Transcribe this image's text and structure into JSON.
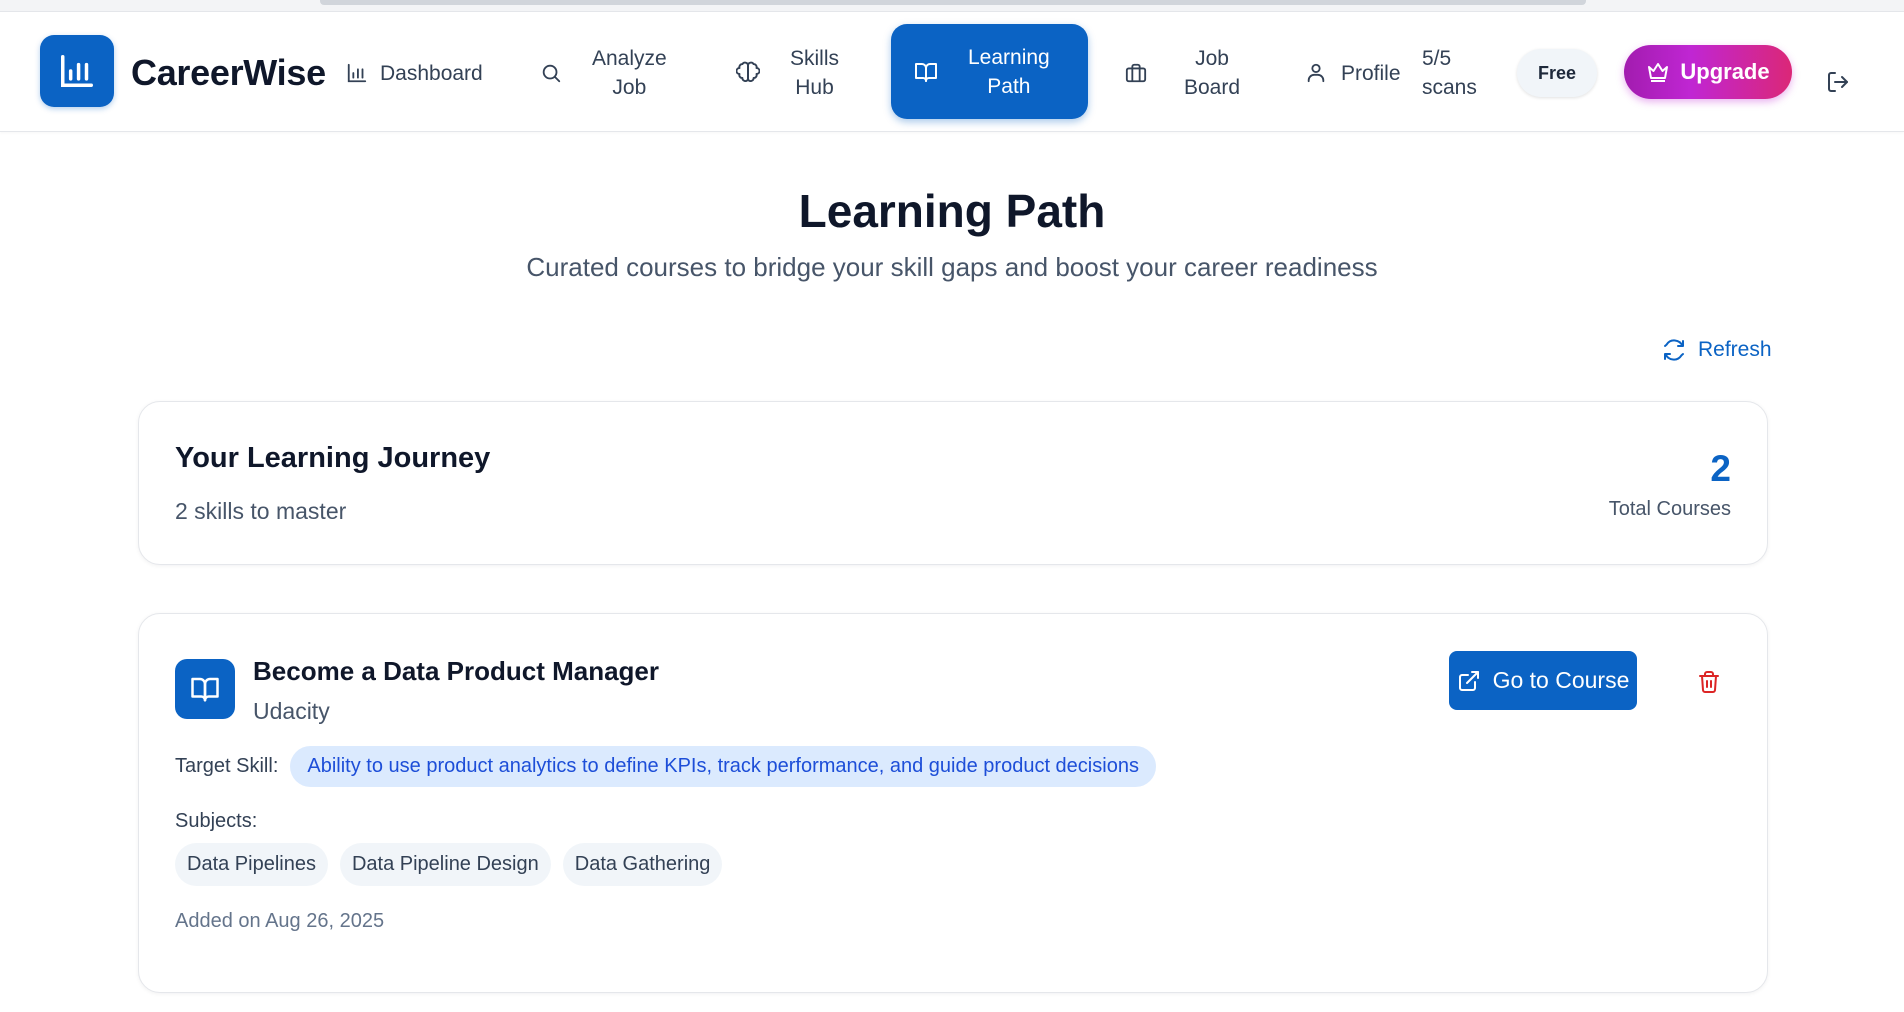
{
  "app": {
    "brand": "CareerWise",
    "accent_color": "#0b63c4"
  },
  "nav": {
    "items": [
      {
        "label": "Dashboard",
        "icon": "bar-chart-icon",
        "active": false
      },
      {
        "label_line1": "Analyze",
        "label_line2": "Job",
        "icon": "search-icon",
        "active": false
      },
      {
        "label_line1": "Skills",
        "label_line2": "Hub",
        "icon": "brain-icon",
        "active": false
      },
      {
        "label_line1": "Learning",
        "label_line2": "Path",
        "icon": "book-open-icon",
        "active": true
      },
      {
        "label_line1": "Job",
        "label_line2": "Board",
        "icon": "briefcase-icon",
        "active": false
      },
      {
        "label": "Profile",
        "icon": "user-icon",
        "active": false
      }
    ],
    "scans_line1": "5/5",
    "scans_line2": "scans",
    "plan_badge": "Free",
    "upgrade_label": "Upgrade",
    "upgrade_icon": "crown-icon",
    "logout_icon": "logout-icon"
  },
  "page": {
    "title": "Learning Path",
    "subtitle": "Curated courses to bridge your skill gaps and boost your career readiness",
    "refresh_label": "Refresh",
    "refresh_icon": "refresh-icon"
  },
  "journey": {
    "title": "Your Learning Journey",
    "subtitle": "2 skills to master",
    "total_count": "2",
    "total_label": "Total Courses"
  },
  "courses": [
    {
      "title": "Become a Data Product Manager",
      "provider": "Udacity",
      "go_label": "Go to Course",
      "target_label": "Target Skill:",
      "target_skill": "Ability to use product analytics to define KPIs, track performance, and guide product decisions",
      "subjects_label": "Subjects:",
      "subjects": [
        "Data Pipelines",
        "Data Pipeline Design",
        "Data Gathering"
      ],
      "added": "Added on Aug 26, 2025"
    }
  ]
}
